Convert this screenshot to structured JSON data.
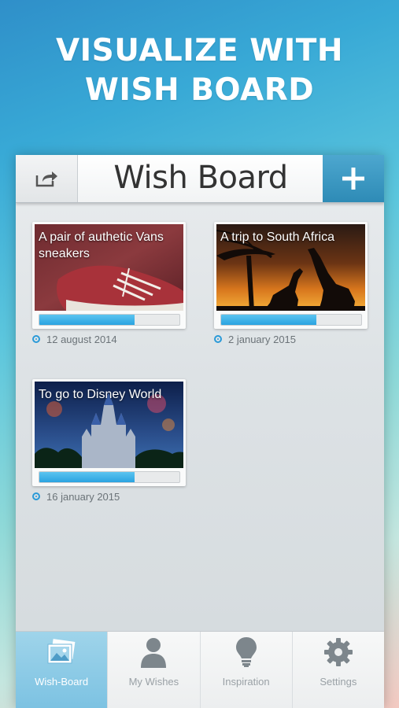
{
  "headline": {
    "line1": "VISUALIZE WITH",
    "line2": "WISH BOARD"
  },
  "navbar": {
    "title": "Wish Board",
    "share_icon": "share-icon",
    "add_icon": "plus-icon"
  },
  "wishes": [
    {
      "title": "A pair of authetic Vans sneakers",
      "date": "12 august 2014",
      "progress": 0.68
    },
    {
      "title": "A trip to South Africa",
      "date": "2 january 2015",
      "progress": 0.68
    },
    {
      "title": "To go to Disney World",
      "date": "16 january 2015",
      "progress": 0.68
    }
  ],
  "tabs": [
    {
      "label": "Wish-Board",
      "icon": "photos-icon",
      "active": true
    },
    {
      "label": "My Wishes",
      "icon": "person-icon",
      "active": false
    },
    {
      "label": "Inspiration",
      "icon": "lightbulb-icon",
      "active": false
    },
    {
      "label": "Settings",
      "icon": "gear-icon",
      "active": false
    }
  ],
  "colors": {
    "accent": "#2a9ad8",
    "progress": "#2aa3e0"
  }
}
